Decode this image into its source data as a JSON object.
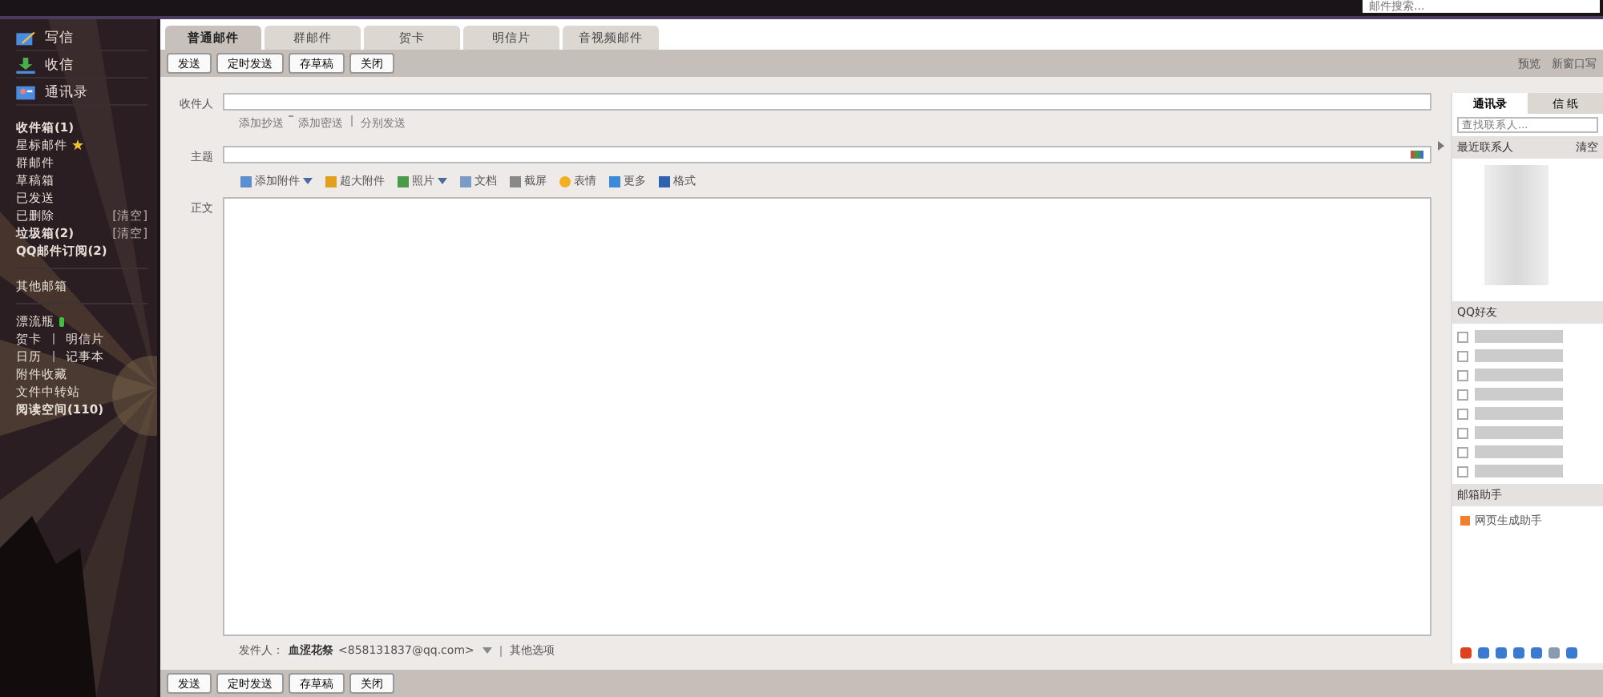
{
  "top_bar": {
    "search": {
      "placeholder": "邮件搜索..."
    }
  },
  "sidebar": {
    "actions": [
      {
        "label": "写信",
        "kind": "compose"
      },
      {
        "label": "收信",
        "kind": "receive"
      },
      {
        "label": "通讯录",
        "kind": "contacts"
      }
    ],
    "folders": [
      {
        "label": "收件箱(1)",
        "bold": true,
        "starred": false
      },
      {
        "label": "星标邮件",
        "bold": false,
        "starred": true
      },
      {
        "label": "群邮件",
        "bold": false,
        "starred": false
      },
      {
        "label": "草稿箱",
        "bold": false,
        "starred": false
      },
      {
        "label": "已发送",
        "bold": false,
        "starred": false
      },
      {
        "label": "已删除",
        "bold": false,
        "starred": false,
        "action": "[清空]"
      },
      {
        "label": "垃圾箱(2)",
        "bold": true,
        "starred": false,
        "action": "[清空]"
      },
      {
        "label": "QQ邮件订阅(2)",
        "bold": true,
        "starred": false
      }
    ],
    "other": "其他邮箱",
    "tools": [
      {
        "items": [
          "漂流瓶"
        ],
        "badge": true
      },
      {
        "items": [
          "贺卡",
          "明信片"
        ],
        "badge": false
      },
      {
        "items": [
          "日历",
          "记事本"
        ],
        "badge": false
      },
      {
        "items": [
          "附件收藏"
        ],
        "badge": false
      },
      {
        "items": [
          "文件中转站"
        ],
        "badge": false
      },
      {
        "items": [
          "阅读空间(110)"
        ],
        "badge": false,
        "bold": true
      }
    ]
  },
  "tabs": [
    {
      "label": "普通邮件",
      "selected": true
    },
    {
      "label": "群邮件",
      "selected": false
    },
    {
      "label": "贺卡",
      "selected": false
    },
    {
      "label": "明信片",
      "selected": false
    },
    {
      "label": "音视频邮件",
      "selected": false
    }
  ],
  "toolbar": {
    "buttons": [
      "发送",
      "定时发送",
      "存草稿",
      "关闭"
    ],
    "links": [
      "预览",
      "新窗口写"
    ]
  },
  "form": {
    "recipient_label": "收件人",
    "recipient_links": [
      "添加抄送",
      "添加密送",
      "分别发送"
    ],
    "subject_label": "主题",
    "attach_tools": [
      {
        "label": "添加附件",
        "kind": "clip",
        "dropdown": true
      },
      {
        "label": "超大附件",
        "kind": "bigclip",
        "dropdown": false
      },
      {
        "label": "照片",
        "dropdown": true
      },
      {
        "label": "文档",
        "kind": "doc",
        "dropdown": false
      },
      {
        "label": "截屏",
        "kind": "cut",
        "dropdown": false
      },
      {
        "label": "表情",
        "kind": "smile",
        "dropdown": false
      },
      {
        "label": "更多",
        "kind": "more",
        "dropdown": false
      },
      {
        "label": "格式",
        "kind": "format",
        "dropdown": false
      }
    ],
    "body_label": "正文",
    "sender_label": "发件人：",
    "sender_name": "血涩花祭",
    "sender_email": "<858131837@qq.com>",
    "other_options": "其他选项"
  },
  "bottom_buttons": [
    "发送",
    "定时发送",
    "存草稿",
    "关闭"
  ],
  "contacts_panel": {
    "tabs": [
      {
        "label": "通讯录",
        "selected": true
      },
      {
        "label": "信 纸",
        "selected": false
      }
    ],
    "search": {
      "placeholder": "查找联系人..."
    },
    "recent": {
      "title": "最近联系人",
      "action": "清空"
    },
    "qq_friends": {
      "title": "QQ好友"
    },
    "assistant": {
      "title": "邮箱助手",
      "item": "网页生成助手"
    }
  }
}
